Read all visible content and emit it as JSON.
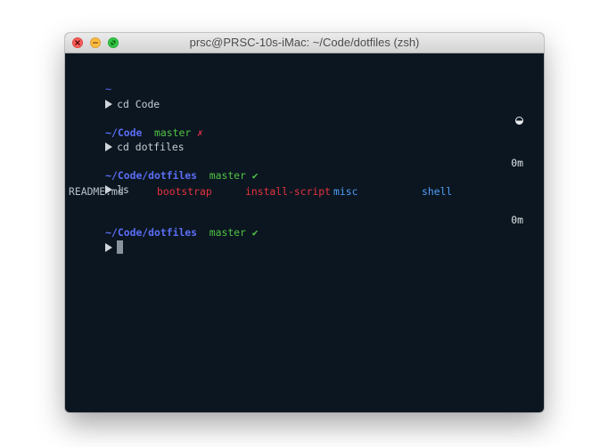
{
  "window": {
    "title": "prsc@PRSC-10s-iMac: ~/Code/dotfiles (zsh)"
  },
  "terminal": {
    "block1": {
      "path": "~",
      "command": "cd Code"
    },
    "block2": {
      "path": "~/Code",
      "branch": "master",
      "status": "✗",
      "command": "cd dotfiles"
    },
    "block3": {
      "path": "~/Code/dotfiles",
      "branch": "master",
      "status": "✔",
      "elapsed": "0m",
      "command": "ls"
    },
    "ls_output": [
      "README.md",
      "bootstrap",
      "install-script",
      "misc",
      "shell"
    ],
    "block4": {
      "path": "~/Code/dotfiles",
      "branch": "master",
      "status": "✔",
      "elapsed": "0m"
    }
  },
  "colors": {
    "background": "#0b1620",
    "path": "#5b6ef5",
    "branch": "#50c244",
    "dirty": "#e8304a",
    "clean": "#4fc443",
    "executable": "#e5323f",
    "directory": "#4e9ef6"
  },
  "icons": {
    "traffic_close": "close-icon",
    "traffic_minimize": "minimize-icon",
    "traffic_maximize": "maximize-icon",
    "prompt": "triangle-right-icon",
    "status_spinner": "half-circle-icon"
  }
}
